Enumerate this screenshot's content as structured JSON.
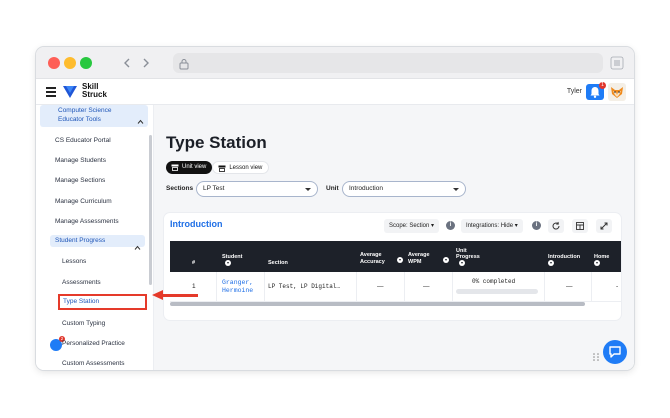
{
  "browser": {
    "traffic_lights": {
      "close": "#fe5f57",
      "minimize": "#febc2e",
      "maximize": "#28c840"
    },
    "back_icon": "chevron-left-icon",
    "forward_icon": "chevron-right-icon",
    "lock_icon": "lock-icon",
    "menu_icon": "menu-icon"
  },
  "app": {
    "logo_line1": "Skill",
    "logo_line2": "Struck",
    "user_name": "Tyler",
    "notification_count": "1",
    "accent_color": "#1f7cf6"
  },
  "sidebar": {
    "section_title": "Computer Science Educator Tools",
    "items": [
      {
        "label": "CS Educator Portal"
      },
      {
        "label": "Manage Students"
      },
      {
        "label": "Manage Sections"
      },
      {
        "label": "Manage Curriculum"
      },
      {
        "label": "Manage Assessments"
      }
    ],
    "group_label": "Student Progress",
    "sub_items": [
      {
        "label": "Lessons"
      },
      {
        "label": "Assessments"
      },
      {
        "label": "Type Station"
      },
      {
        "label": "Custom Typing"
      },
      {
        "label": "Personalized Practice"
      },
      {
        "label": "Custom Assessments"
      }
    ],
    "practice_badge": "2",
    "selected": "Type Station"
  },
  "main": {
    "title": "Type Station",
    "unit_view_label": "Unit view",
    "lesson_view_label": "Lesson view",
    "sections_label": "Sections",
    "sections_value": "LP Test",
    "unit_label": "Unit",
    "unit_value": "Introduction"
  },
  "card": {
    "title": "Introduction",
    "scope_label": "Scope: Section",
    "integrations_label": "Integrations: Hide",
    "info": "i",
    "columns": [
      "#",
      "Student",
      "Section",
      "Average Accuracy",
      "Average WPM",
      "Unit Progress",
      "Introduction",
      "Home"
    ],
    "rows": [
      {
        "index": "1",
        "student": "Granger, Hermoine",
        "section": "LP Test, LP Digital…",
        "accuracy": "—",
        "wpm": "—",
        "progress": "0% completed",
        "progress_value": 0,
        "introduction": "—",
        "home": "-"
      }
    ]
  },
  "annotation": {
    "color": "#e53a2a"
  }
}
